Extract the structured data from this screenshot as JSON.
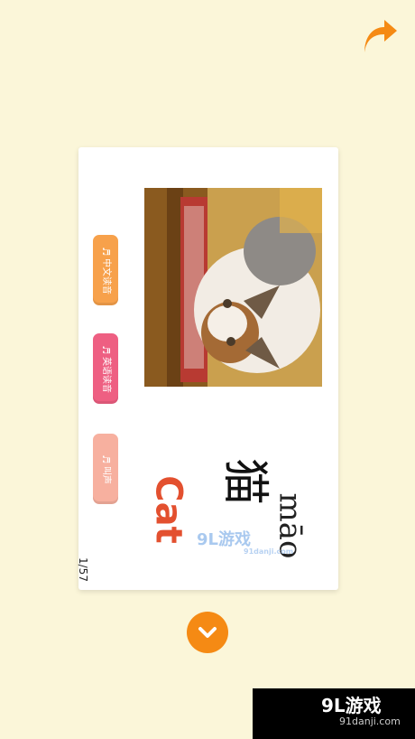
{
  "card": {
    "audio_buttons": [
      {
        "label": "中文读音",
        "icon": "speaker-icon"
      },
      {
        "label": "英语读音",
        "icon": "speaker-icon"
      },
      {
        "label": "叫声",
        "icon": "speaker-icon"
      }
    ],
    "pinyin": "māo",
    "hanzi": "猫",
    "english": "Cat",
    "counter": "1/57"
  },
  "watermark_card": {
    "brand": "9L游戏",
    "url": "91danji.com"
  },
  "brand_bar": {
    "brand": "9L游戏",
    "url": "91danji.com"
  },
  "colors": {
    "background": "#fbf6d9",
    "accent": "#f58a14",
    "english_word": "#e3502f"
  }
}
